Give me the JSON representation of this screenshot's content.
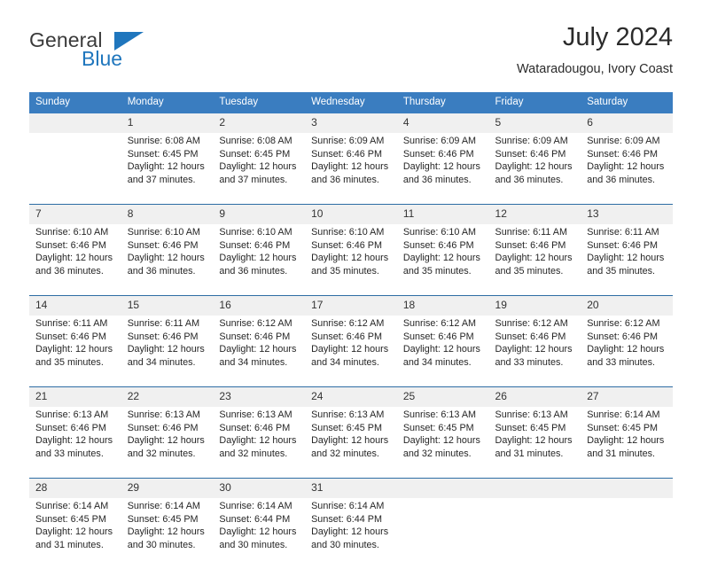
{
  "brand": {
    "name_part1": "General",
    "name_part2": "Blue",
    "colors": {
      "blue": "#1f76bd",
      "dark": "#3a3a3a"
    }
  },
  "header": {
    "title": "July 2024",
    "subtitle": "Wataradougou, Ivory Coast"
  },
  "theme": {
    "header_bg": "#3a7dc0",
    "daynum_bg": "#f0f0f0",
    "week_divider": "#2e6da4",
    "text": "#262626"
  },
  "calendar": {
    "weekdays": [
      "Sunday",
      "Monday",
      "Tuesday",
      "Wednesday",
      "Thursday",
      "Friday",
      "Saturday"
    ],
    "labels": {
      "sunrise": "Sunrise:",
      "sunset": "Sunset:",
      "daylight": "Daylight:"
    },
    "weeks": [
      [
        {
          "day": "",
          "lines": []
        },
        {
          "day": "1",
          "lines": [
            "Sunrise: 6:08 AM",
            "Sunset: 6:45 PM",
            "Daylight: 12 hours",
            "and 37 minutes."
          ]
        },
        {
          "day": "2",
          "lines": [
            "Sunrise: 6:08 AM",
            "Sunset: 6:45 PM",
            "Daylight: 12 hours",
            "and 37 minutes."
          ]
        },
        {
          "day": "3",
          "lines": [
            "Sunrise: 6:09 AM",
            "Sunset: 6:46 PM",
            "Daylight: 12 hours",
            "and 36 minutes."
          ]
        },
        {
          "day": "4",
          "lines": [
            "Sunrise: 6:09 AM",
            "Sunset: 6:46 PM",
            "Daylight: 12 hours",
            "and 36 minutes."
          ]
        },
        {
          "day": "5",
          "lines": [
            "Sunrise: 6:09 AM",
            "Sunset: 6:46 PM",
            "Daylight: 12 hours",
            "and 36 minutes."
          ]
        },
        {
          "day": "6",
          "lines": [
            "Sunrise: 6:09 AM",
            "Sunset: 6:46 PM",
            "Daylight: 12 hours",
            "and 36 minutes."
          ]
        }
      ],
      [
        {
          "day": "7",
          "lines": [
            "Sunrise: 6:10 AM",
            "Sunset: 6:46 PM",
            "Daylight: 12 hours",
            "and 36 minutes."
          ]
        },
        {
          "day": "8",
          "lines": [
            "Sunrise: 6:10 AM",
            "Sunset: 6:46 PM",
            "Daylight: 12 hours",
            "and 36 minutes."
          ]
        },
        {
          "day": "9",
          "lines": [
            "Sunrise: 6:10 AM",
            "Sunset: 6:46 PM",
            "Daylight: 12 hours",
            "and 36 minutes."
          ]
        },
        {
          "day": "10",
          "lines": [
            "Sunrise: 6:10 AM",
            "Sunset: 6:46 PM",
            "Daylight: 12 hours",
            "and 35 minutes."
          ]
        },
        {
          "day": "11",
          "lines": [
            "Sunrise: 6:10 AM",
            "Sunset: 6:46 PM",
            "Daylight: 12 hours",
            "and 35 minutes."
          ]
        },
        {
          "day": "12",
          "lines": [
            "Sunrise: 6:11 AM",
            "Sunset: 6:46 PM",
            "Daylight: 12 hours",
            "and 35 minutes."
          ]
        },
        {
          "day": "13",
          "lines": [
            "Sunrise: 6:11 AM",
            "Sunset: 6:46 PM",
            "Daylight: 12 hours",
            "and 35 minutes."
          ]
        }
      ],
      [
        {
          "day": "14",
          "lines": [
            "Sunrise: 6:11 AM",
            "Sunset: 6:46 PM",
            "Daylight: 12 hours",
            "and 35 minutes."
          ]
        },
        {
          "day": "15",
          "lines": [
            "Sunrise: 6:11 AM",
            "Sunset: 6:46 PM",
            "Daylight: 12 hours",
            "and 34 minutes."
          ]
        },
        {
          "day": "16",
          "lines": [
            "Sunrise: 6:12 AM",
            "Sunset: 6:46 PM",
            "Daylight: 12 hours",
            "and 34 minutes."
          ]
        },
        {
          "day": "17",
          "lines": [
            "Sunrise: 6:12 AM",
            "Sunset: 6:46 PM",
            "Daylight: 12 hours",
            "and 34 minutes."
          ]
        },
        {
          "day": "18",
          "lines": [
            "Sunrise: 6:12 AM",
            "Sunset: 6:46 PM",
            "Daylight: 12 hours",
            "and 34 minutes."
          ]
        },
        {
          "day": "19",
          "lines": [
            "Sunrise: 6:12 AM",
            "Sunset: 6:46 PM",
            "Daylight: 12 hours",
            "and 33 minutes."
          ]
        },
        {
          "day": "20",
          "lines": [
            "Sunrise: 6:12 AM",
            "Sunset: 6:46 PM",
            "Daylight: 12 hours",
            "and 33 minutes."
          ]
        }
      ],
      [
        {
          "day": "21",
          "lines": [
            "Sunrise: 6:13 AM",
            "Sunset: 6:46 PM",
            "Daylight: 12 hours",
            "and 33 minutes."
          ]
        },
        {
          "day": "22",
          "lines": [
            "Sunrise: 6:13 AM",
            "Sunset: 6:46 PM",
            "Daylight: 12 hours",
            "and 32 minutes."
          ]
        },
        {
          "day": "23",
          "lines": [
            "Sunrise: 6:13 AM",
            "Sunset: 6:46 PM",
            "Daylight: 12 hours",
            "and 32 minutes."
          ]
        },
        {
          "day": "24",
          "lines": [
            "Sunrise: 6:13 AM",
            "Sunset: 6:45 PM",
            "Daylight: 12 hours",
            "and 32 minutes."
          ]
        },
        {
          "day": "25",
          "lines": [
            "Sunrise: 6:13 AM",
            "Sunset: 6:45 PM",
            "Daylight: 12 hours",
            "and 32 minutes."
          ]
        },
        {
          "day": "26",
          "lines": [
            "Sunrise: 6:13 AM",
            "Sunset: 6:45 PM",
            "Daylight: 12 hours",
            "and 31 minutes."
          ]
        },
        {
          "day": "27",
          "lines": [
            "Sunrise: 6:14 AM",
            "Sunset: 6:45 PM",
            "Daylight: 12 hours",
            "and 31 minutes."
          ]
        }
      ],
      [
        {
          "day": "28",
          "lines": [
            "Sunrise: 6:14 AM",
            "Sunset: 6:45 PM",
            "Daylight: 12 hours",
            "and 31 minutes."
          ]
        },
        {
          "day": "29",
          "lines": [
            "Sunrise: 6:14 AM",
            "Sunset: 6:45 PM",
            "Daylight: 12 hours",
            "and 30 minutes."
          ]
        },
        {
          "day": "30",
          "lines": [
            "Sunrise: 6:14 AM",
            "Sunset: 6:44 PM",
            "Daylight: 12 hours",
            "and 30 minutes."
          ]
        },
        {
          "day": "31",
          "lines": [
            "Sunrise: 6:14 AM",
            "Sunset: 6:44 PM",
            "Daylight: 12 hours",
            "and 30 minutes."
          ]
        },
        {
          "day": "",
          "lines": []
        },
        {
          "day": "",
          "lines": []
        },
        {
          "day": "",
          "lines": []
        }
      ]
    ]
  }
}
